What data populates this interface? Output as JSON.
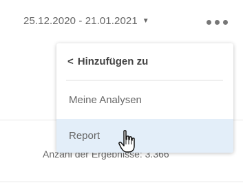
{
  "toolbar": {
    "date_range": "25.12.2020 - 21.01.2021",
    "caret_icon": "caret-down-icon",
    "more_icon": "more-horizontal-icon"
  },
  "background": {
    "results_text": "Anzahl der Ergebnisse: 3.366"
  },
  "menu": {
    "back_icon": "chevron-left-icon",
    "title": "Hinzufügen zu",
    "items": [
      {
        "label": "Meine Analysen"
      },
      {
        "label": "Report",
        "hovered": true
      }
    ]
  },
  "cursor_icon": "hand-pointer-icon",
  "colors": {
    "hover_background": "#e3eef9",
    "text": "#666666"
  }
}
